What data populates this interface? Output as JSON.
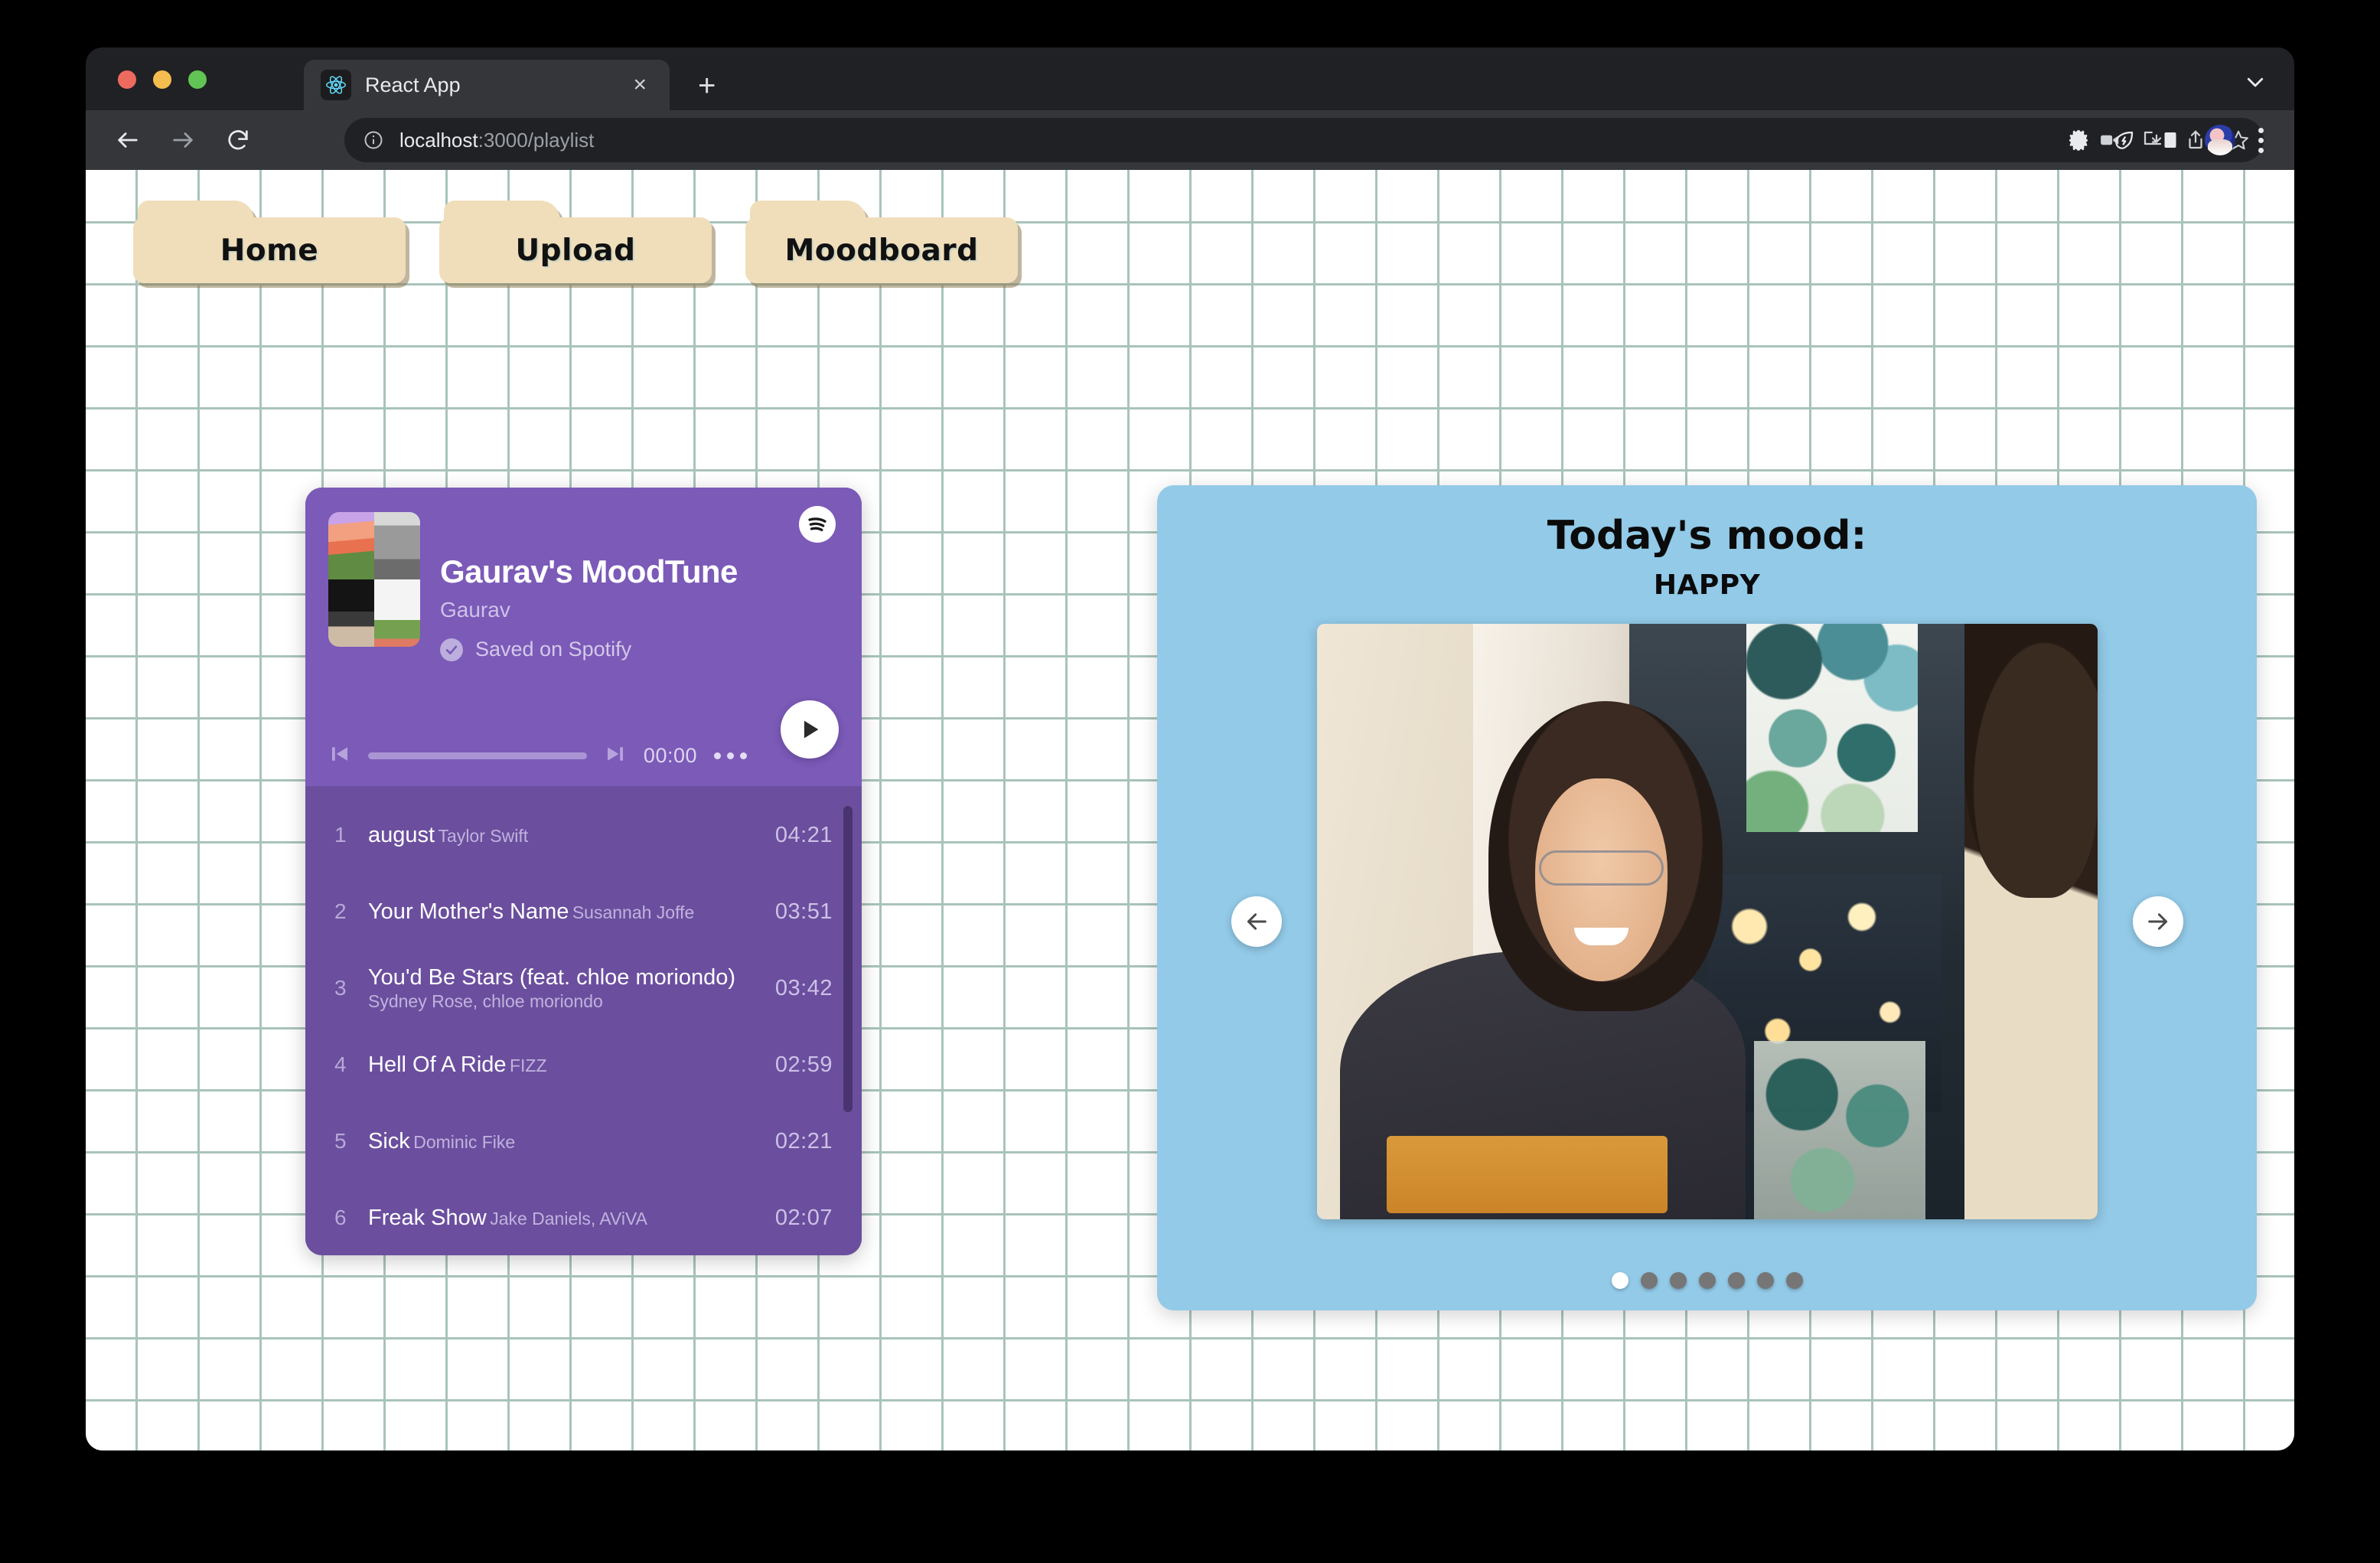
{
  "browser": {
    "tab": {
      "title": "React App",
      "favicon_icon": "react-logo-icon",
      "close_icon": "close-icon"
    },
    "new_tab_label": "+",
    "tabstrip_chevron_icon": "chevron-down-icon",
    "toolbar": {
      "back_icon": "arrow-left-icon",
      "forward_icon": "arrow-right-icon",
      "reload_icon": "reload-icon",
      "site_info_icon": "info-circle-icon",
      "url_host": "localhost",
      "url_path": ":3000/playlist",
      "record_icon": "video-camera-icon",
      "install_icon": "install-download-icon",
      "share_icon": "share-upload-icon",
      "bookmark_icon": "star-icon",
      "extensions_icon": "puzzle-piece-icon",
      "performance_icon": "leaf-bolt-icon",
      "side_panel_icon": "side-panel-icon",
      "profile_icon": "avatar-icon",
      "menu_icon": "kebab-menu-icon"
    }
  },
  "nav": {
    "tabs": [
      {
        "label": "Home"
      },
      {
        "label": "Upload"
      },
      {
        "label": "Moodboard"
      }
    ]
  },
  "playlist": {
    "title": "Gaurav's MoodTune",
    "owner": "Gaurav",
    "saved_label": "Saved on Spotify",
    "saved_check_icon": "check-circle-icon",
    "spotify_icon": "spotify-icon",
    "play_icon": "play-icon",
    "prev_icon": "skip-previous-icon",
    "next_icon": "skip-next-icon",
    "more_icon": "more-horizontal-icon",
    "elapsed": "00:00",
    "progress_percent": 0,
    "tracks": [
      {
        "index": "1",
        "name": "august",
        "artist": "Taylor Swift",
        "duration": "04:21"
      },
      {
        "index": "2",
        "name": "Your Mother's Name",
        "artist": "Susannah Joffe",
        "duration": "03:51"
      },
      {
        "index": "3",
        "name": "You'd Be Stars (feat. chloe moriondo)",
        "artist": "Sydney Rose, chloe moriondo",
        "duration": "03:42"
      },
      {
        "index": "4",
        "name": "Hell Of A Ride",
        "artist": "FIZZ",
        "duration": "02:59"
      },
      {
        "index": "5",
        "name": "Sick",
        "artist": "Dominic Fike",
        "duration": "02:21"
      },
      {
        "index": "6",
        "name": "Freak Show",
        "artist": "Jake Daniels, AViVA",
        "duration": "02:07"
      }
    ]
  },
  "mood": {
    "title": "Today's mood:",
    "value": "HAPPY",
    "prev_icon": "arrow-left-icon",
    "next_icon": "arrow-right-icon",
    "slide_count": 7,
    "active_slide": 1
  },
  "colors": {
    "playlist_header": "#7b5ab8",
    "playlist_body": "#6b4f9e",
    "mood_card": "#92cae8",
    "folder_tab": "#f0debb",
    "grid_line": "#a9c3ba"
  }
}
